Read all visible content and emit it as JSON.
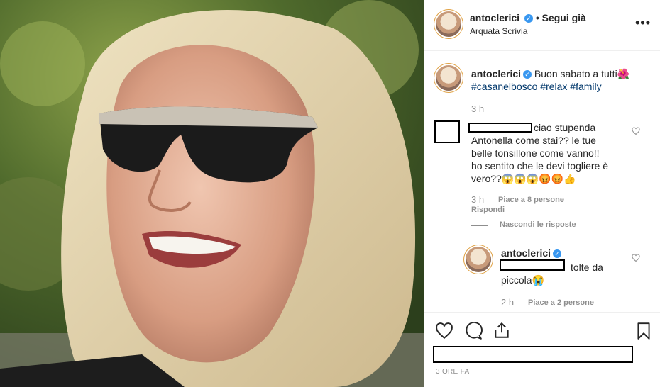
{
  "header": {
    "username": "antoclerici",
    "follow_label": "• Segui già",
    "location": "Arquata Scrivia",
    "more_icon": "more-horizontal-icon"
  },
  "caption": {
    "username": "antoclerici",
    "text": "Buon sabato a tutti🌺",
    "hashtags": "#casanelbosco #relax #family",
    "time": "3 h"
  },
  "comment1": {
    "text_line1": "ciao stupenda",
    "text_rest": "Antonella come stai?? le tue belle tonsillone come vanno!! ho sentito che le devi togliere è vero??😱😱😱😡😡👍",
    "time": "3 h",
    "likes": "Piace a 8 persone",
    "reply": "Rispondi",
    "hide_replies": "Nascondi le risposte"
  },
  "reply1": {
    "username": "antoclerici",
    "text_line1": "tolte da",
    "text_line2": "piccola😭",
    "time": "2 h",
    "likes": "Piace a 2 persone"
  },
  "footer": {
    "timestamp": "3 ORE FA"
  },
  "icons": {
    "like": "heart-icon",
    "comment": "comment-icon",
    "share": "share-icon",
    "save": "bookmark-icon"
  }
}
